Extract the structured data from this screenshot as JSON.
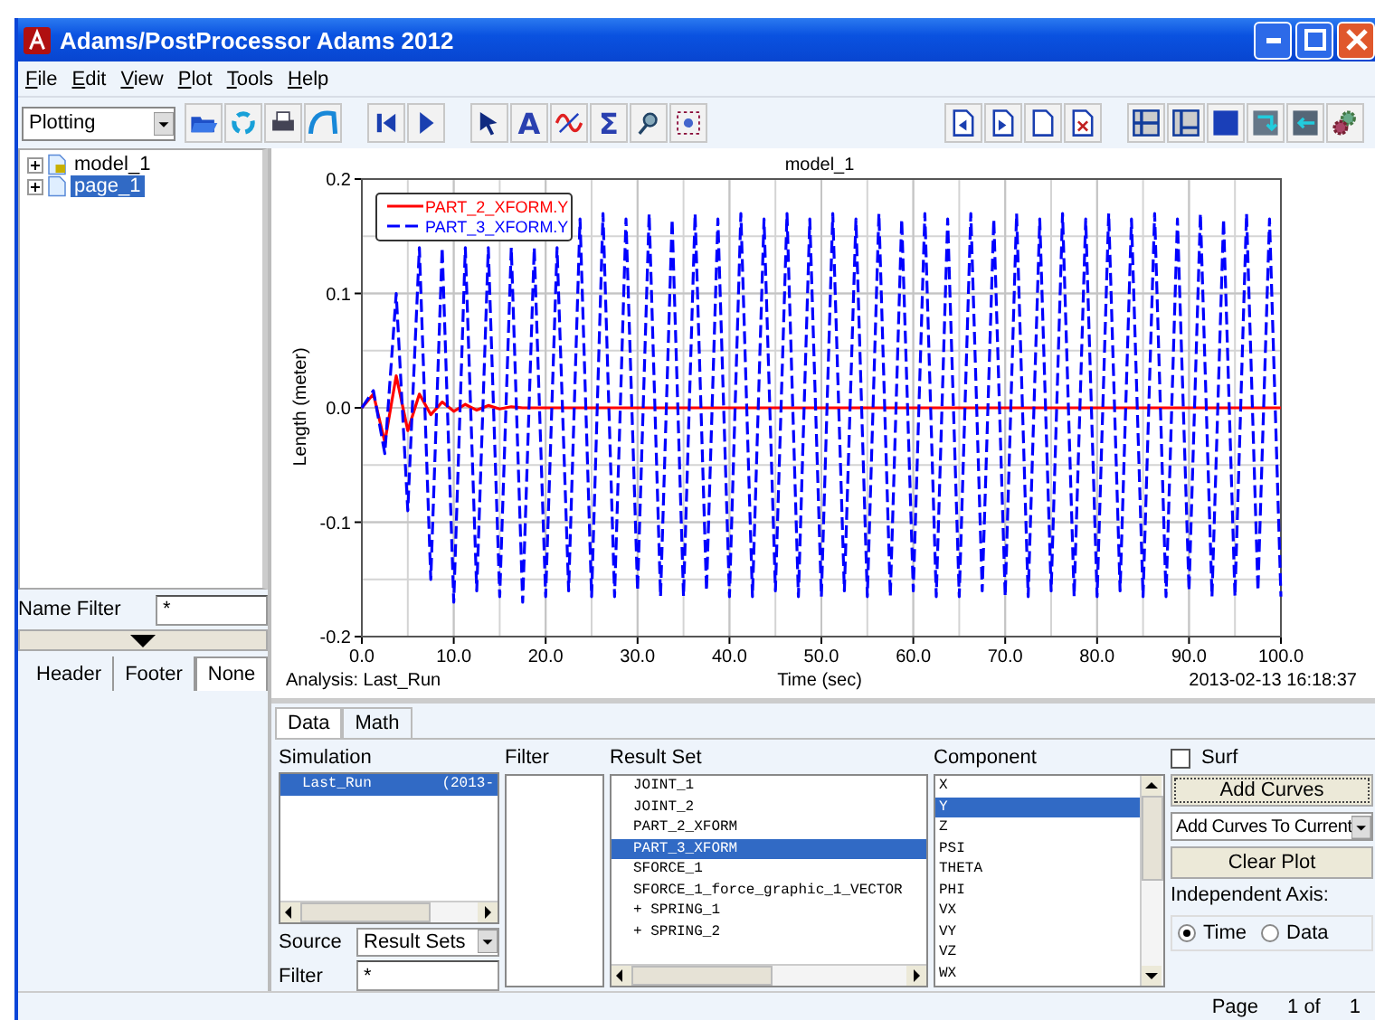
{
  "window": {
    "title": "Adams/PostProcessor Adams 2012"
  },
  "menu": [
    {
      "label": "File"
    },
    {
      "label": "Edit"
    },
    {
      "label": "View"
    },
    {
      "label": "Plot"
    },
    {
      "label": "Tools"
    },
    {
      "label": "Help"
    }
  ],
  "toolbar": {
    "mode": "Plotting",
    "glyphs": [
      "A",
      "Σ"
    ]
  },
  "tree": [
    {
      "label": "model_1",
      "expanded": false,
      "selected": false,
      "kind": "model"
    },
    {
      "label": "page_1",
      "expanded": false,
      "selected": true,
      "kind": "page"
    }
  ],
  "name_filter": {
    "label": "Name Filter",
    "value": "*"
  },
  "left_tabs": [
    {
      "label": "Header",
      "selected": false
    },
    {
      "label": "Footer",
      "selected": false
    },
    {
      "label": "None",
      "selected": true
    }
  ],
  "plot": {
    "analysis": "Analysis:  Last_Run",
    "timestamp": "2013-02-13 16:18:37",
    "chart_data": {
      "type": "line",
      "grid": true,
      "legend": true,
      "title": "model_1",
      "xlabel": "Time (sec)",
      "ylabel": "Length (meter)",
      "xlim": [
        0,
        100
      ],
      "ylim": [
        -0.2,
        0.2
      ],
      "xticks": [
        {
          "value": 0,
          "label": "0.0"
        },
        {
          "value": 10,
          "label": "10.0"
        },
        {
          "value": 20,
          "label": "20.0"
        },
        {
          "value": 30,
          "label": "30.0"
        },
        {
          "value": 40,
          "label": "40.0"
        },
        {
          "value": 50,
          "label": "50.0"
        },
        {
          "value": 60,
          "label": "60.0"
        },
        {
          "value": 70,
          "label": "70.0"
        },
        {
          "value": 80,
          "label": "80.0"
        },
        {
          "value": 90,
          "label": "90.0"
        },
        {
          "value": 100,
          "label": "100.0"
        }
      ],
      "yticks": [
        {
          "value": -0.2,
          "label": "-0.2"
        },
        {
          "value": -0.1,
          "label": "-0.1"
        },
        {
          "value": 0,
          "label": "0.0"
        },
        {
          "value": 0.1,
          "label": "0.1"
        },
        {
          "value": 0.2,
          "label": "0.2"
        }
      ],
      "x": [
        0,
        1.25,
        2.5,
        3.75,
        5,
        6.25,
        7.5,
        8.75,
        10,
        11.25,
        12.5,
        13.75,
        15,
        16.25,
        17.5,
        18.75,
        20,
        21.25,
        22.5,
        23.75,
        25,
        26.25,
        27.5,
        28.75,
        30,
        31.25,
        32.5,
        33.75,
        35,
        36.25,
        37.5,
        38.75,
        40,
        41.25,
        42.5,
        43.75,
        45,
        46.25,
        47.5,
        48.75,
        50,
        51.25,
        52.5,
        53.75,
        55,
        56.25,
        57.5,
        58.75,
        60,
        61.25,
        62.5,
        63.75,
        65,
        66.25,
        67.5,
        68.75,
        70,
        71.25,
        72.5,
        73.75,
        75,
        76.25,
        77.5,
        78.75,
        80,
        81.25,
        82.5,
        83.75,
        85,
        86.25,
        87.5,
        88.75,
        90,
        91.25,
        92.5,
        93.75,
        95,
        96.25,
        97.5,
        98.75,
        100
      ],
      "series": [
        {
          "name": "PART_2_XFORM.Y",
          "color": "#ff0000",
          "line_style": "solid",
          "values": [
            0,
            0.012,
            -0.03,
            0.028,
            -0.02,
            0.012,
            -0.006,
            0.005,
            -0.003,
            0.003,
            -0.002,
            0.002,
            -0.001,
            0.001,
            0,
            0,
            0,
            0,
            0,
            0,
            0,
            0,
            0,
            0,
            0,
            0,
            0,
            0,
            0,
            0,
            0,
            0,
            0,
            0,
            0,
            0,
            0,
            0,
            0,
            0,
            0,
            0,
            0,
            0,
            0,
            0,
            0,
            0,
            0,
            0,
            0,
            0,
            0,
            0,
            0,
            0,
            0,
            0,
            0,
            0,
            0,
            0,
            0,
            0,
            0,
            0,
            0,
            0,
            0,
            0,
            0,
            0,
            0,
            0,
            0,
            0,
            0,
            0,
            0,
            0,
            0
          ]
        },
        {
          "name": "PART_3_XFORM.Y",
          "color": "#0000ff",
          "line_style": "dashed",
          "values": [
            0,
            0.015,
            -0.04,
            0.1,
            -0.09,
            0.14,
            -0.15,
            0.14,
            -0.17,
            0.14,
            -0.16,
            0.14,
            -0.165,
            0.14,
            -0.17,
            0.14,
            -0.165,
            0.14,
            -0.16,
            0.165,
            -0.165,
            0.17,
            -0.165,
            0.165,
            -0.16,
            0.17,
            -0.165,
            0.165,
            -0.165,
            0.17,
            -0.16,
            0.165,
            -0.165,
            0.17,
            -0.165,
            0.165,
            -0.16,
            0.17,
            -0.165,
            0.165,
            -0.165,
            0.17,
            -0.16,
            0.165,
            -0.165,
            0.17,
            -0.165,
            0.165,
            -0.16,
            0.17,
            -0.165,
            0.165,
            -0.165,
            0.17,
            -0.16,
            0.165,
            -0.165,
            0.17,
            -0.165,
            0.165,
            -0.16,
            0.17,
            -0.165,
            0.165,
            -0.165,
            0.17,
            -0.16,
            0.165,
            -0.165,
            0.17,
            -0.165,
            0.165,
            -0.16,
            0.17,
            -0.165,
            0.165,
            -0.165,
            0.17,
            -0.16,
            0.165,
            -0.165
          ]
        }
      ]
    }
  },
  "data_tabs": [
    {
      "label": "Data",
      "selected": true
    },
    {
      "label": "Math",
      "selected": false
    }
  ],
  "simulation": {
    "label": "Simulation",
    "items": [
      {
        "name": "Last_Run",
        "date": "(2013-",
        "selected": true
      }
    ],
    "source_label": "Source",
    "source": "Result Sets",
    "filter_label": "Filter",
    "filter": "*"
  },
  "filter_column": {
    "label": "Filter"
  },
  "result_set": {
    "label": "Result Set",
    "items": [
      {
        "label": "JOINT_1",
        "selected": false
      },
      {
        "label": "JOINT_2",
        "selected": false
      },
      {
        "label": "PART_2_XFORM",
        "selected": false
      },
      {
        "label": "PART_3_XFORM",
        "selected": true
      },
      {
        "label": "SFORCE_1",
        "selected": false
      },
      {
        "label": "SFORCE_1_force_graphic_1_VECTOR",
        "selected": false
      },
      {
        "label": "+ SPRING_1",
        "selected": false
      },
      {
        "label": "+ SPRING_2",
        "selected": false
      }
    ]
  },
  "component": {
    "label": "Component",
    "items": [
      {
        "label": "X",
        "selected": false
      },
      {
        "label": "Y",
        "selected": true
      },
      {
        "label": "Z",
        "selected": false
      },
      {
        "label": "PSI",
        "selected": false
      },
      {
        "label": "THETA",
        "selected": false
      },
      {
        "label": "PHI",
        "selected": false
      },
      {
        "label": "VX",
        "selected": false
      },
      {
        "label": "VY",
        "selected": false
      },
      {
        "label": "VZ",
        "selected": false
      },
      {
        "label": "WX",
        "selected": false
      }
    ]
  },
  "actions": {
    "surf": {
      "label": "Surf",
      "checked": false
    },
    "add_curves": "Add Curves",
    "add_mode": "Add Curves To Current",
    "clear_plot": "Clear Plot",
    "axis_label": "Independent Axis:",
    "axis_options": [
      {
        "label": "Time",
        "selected": true
      },
      {
        "label": "Data",
        "selected": false
      }
    ]
  },
  "status_bar": {
    "page_label": "Page",
    "page": "1 of",
    "total": "1"
  }
}
